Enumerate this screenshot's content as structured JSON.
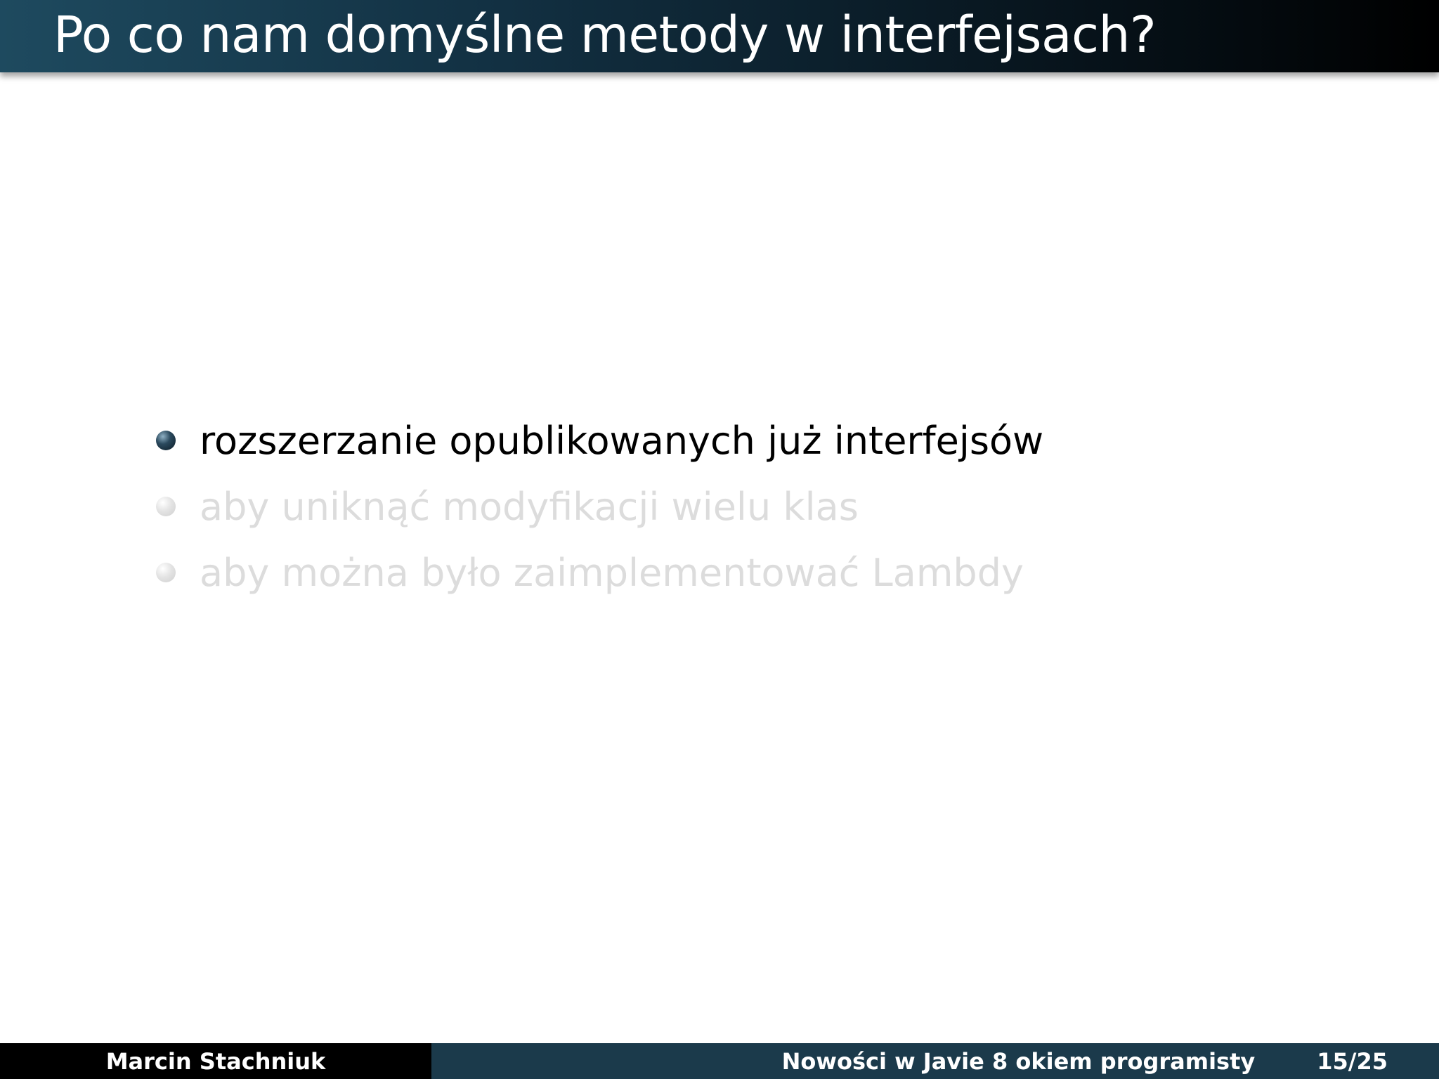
{
  "slide": {
    "title": "Po co nam domyślne metody w interfejsach?",
    "bullets": [
      {
        "text": "rozszerzanie opublikowanych już interfejsów",
        "state": "active"
      },
      {
        "text": "aby uniknąć modyfikacji wielu klas",
        "state": "dimmed"
      },
      {
        "text": "aby można było zaimplementować Lambdy",
        "state": "dimmed"
      }
    ]
  },
  "footer": {
    "author": "Marcin Stachniuk",
    "talk_title": "Nowości w Javie 8 okiem programisty",
    "page": "15/25"
  },
  "colors": {
    "title_bar_start": "#1e4a5f",
    "title_bar_end": "#000000",
    "footer_left_bg": "#000000",
    "footer_right_bg": "#1b3a4b",
    "dimmed_text": "#dcdcdc"
  }
}
